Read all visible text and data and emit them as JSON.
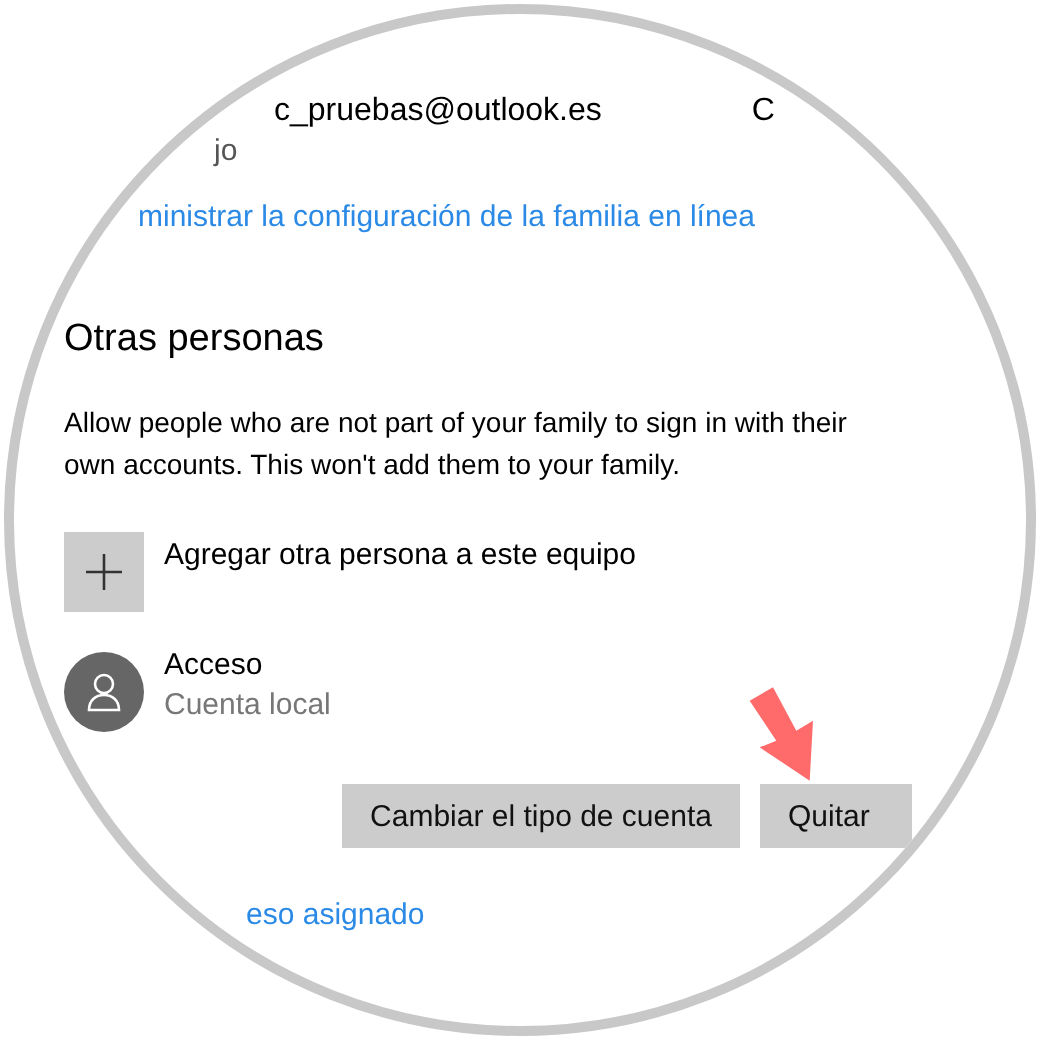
{
  "account": {
    "email": "c_pruebas@outlook.es",
    "column_2": "C",
    "role": "jo"
  },
  "family_link": "ministrar la configuración de la familia en línea",
  "other_people": {
    "heading": "Otras personas",
    "description": "Allow people who are not part of your family to sign in with their own accounts. This won't add them to your family.",
    "add_label": "Agregar otra persona a este equipo",
    "users": [
      {
        "name": "Acceso",
        "type": "Cuenta local"
      }
    ],
    "buttons": [
      "Cambiar el tipo de cuenta",
      "Quitar"
    ]
  },
  "assigned_access_link": "eso asignado"
}
